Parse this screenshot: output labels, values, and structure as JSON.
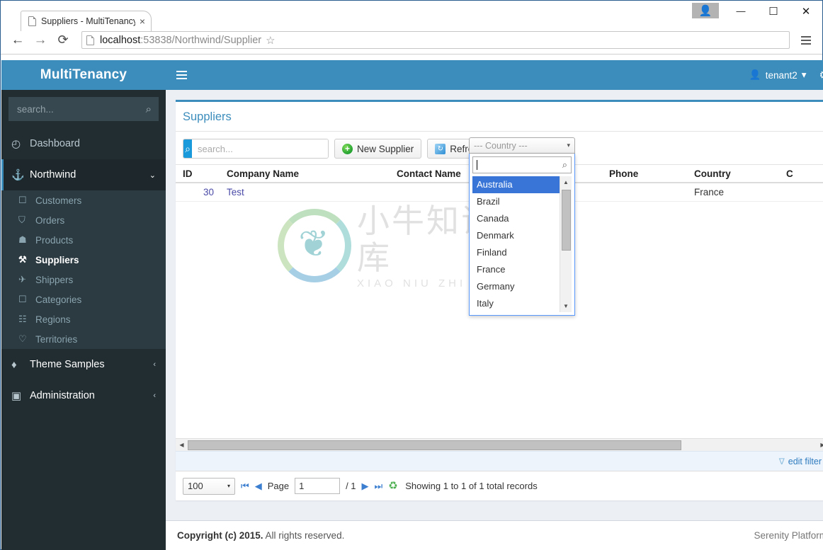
{
  "browser": {
    "tab_title": "Suppliers - MultiTenancy",
    "tab_close": "×",
    "back_icon": "←",
    "forward_icon": "→",
    "reload_icon": "⟳",
    "url_host": "localhost",
    "url_rest": ":53838/Northwind/Supplier",
    "star_icon": "☆",
    "window_user_icon": "👤",
    "window_minimize": "—",
    "window_maximize": "☐",
    "window_close": "✕"
  },
  "sidebar": {
    "brand": "MultiTenancy",
    "search_placeholder": "search...",
    "search_value": "",
    "search_icon": "⌕",
    "items": [
      {
        "label": "Dashboard",
        "icon": "◴"
      },
      {
        "label": "Northwind",
        "icon": "⚓",
        "chevron": "⌄"
      },
      {
        "label": "Theme Samples",
        "icon": "♦",
        "chevron": "‹"
      },
      {
        "label": "Administration",
        "icon": "▣",
        "chevron": "‹"
      }
    ],
    "northwind_children": [
      {
        "label": "Customers",
        "icon": "☐"
      },
      {
        "label": "Orders",
        "icon": "⛉"
      },
      {
        "label": "Products",
        "icon": "☗"
      },
      {
        "label": "Suppliers",
        "icon": "⚒"
      },
      {
        "label": "Shippers",
        "icon": "✈"
      },
      {
        "label": "Categories",
        "icon": "☐"
      },
      {
        "label": "Regions",
        "icon": "☷"
      },
      {
        "label": "Territories",
        "icon": "♡"
      }
    ]
  },
  "topbar": {
    "burger_icon": "☰",
    "user_icon": "👤",
    "user_name": "tenant2",
    "user_caret": "▾",
    "gear_icon": "⚙"
  },
  "page": {
    "title": "Suppliers"
  },
  "toolbar": {
    "search_placeholder": "search...",
    "search_value": "",
    "search_icon": "⌕",
    "new_label": "New Supplier",
    "new_icon": "+",
    "refresh_label": "Refresh",
    "refresh_icon": "↻"
  },
  "country_filter": {
    "placeholder": "--- Country ---",
    "arrow_icon": "▾",
    "search_value": "",
    "search_icon": "⌕",
    "options": [
      "Australia",
      "Brazil",
      "Canada",
      "Denmark",
      "Finland",
      "France",
      "Germany",
      "Italy"
    ],
    "selected": "Australia",
    "scroll_up_icon": "▲",
    "scroll_down_icon": "▼"
  },
  "grid": {
    "columns": [
      {
        "key": "id",
        "label": "ID"
      },
      {
        "key": "company",
        "label": "Company Name"
      },
      {
        "key": "contact",
        "label": "Contact Name"
      },
      {
        "key": "phone",
        "label": "Phone"
      },
      {
        "key": "country",
        "label": "Country"
      },
      {
        "key": "city",
        "label": "C"
      }
    ],
    "rows": [
      {
        "id": "30",
        "company": "Test",
        "contact": "",
        "phone": "",
        "country": "France",
        "city": ""
      }
    ],
    "hscroll_left_icon": "◀",
    "hscroll_right_icon": "▶"
  },
  "watermark": {
    "cn_text": "小牛知识库",
    "en_text": "XIAO NIU ZHI SHI KU",
    "animal_glyph": "❦"
  },
  "filter_bar": {
    "funnel_icon": "∇",
    "label": "edit filter"
  },
  "pager": {
    "page_size": "100",
    "page_size_arrow": "▾",
    "first_icon": "⏮",
    "prev_icon": "◀",
    "page_label": "Page",
    "page_value": "1",
    "page_total": "/ 1",
    "next_icon": "▶",
    "last_icon": "⏭",
    "refresh_icon": "♻",
    "status": "Showing 1 to 1 of 1 total records"
  },
  "footer": {
    "copyright_bold": "Copyright (c) 2015.",
    "copyright_rest": " All rights reserved.",
    "platform": "Serenity Platform"
  },
  "colors": {
    "brand_blue": "#3c8dbc",
    "sidebar_dark": "#222d32",
    "sidebar_sub": "#2c3b41",
    "accent_select": "#3875d7",
    "link": "#2f7cc0"
  }
}
